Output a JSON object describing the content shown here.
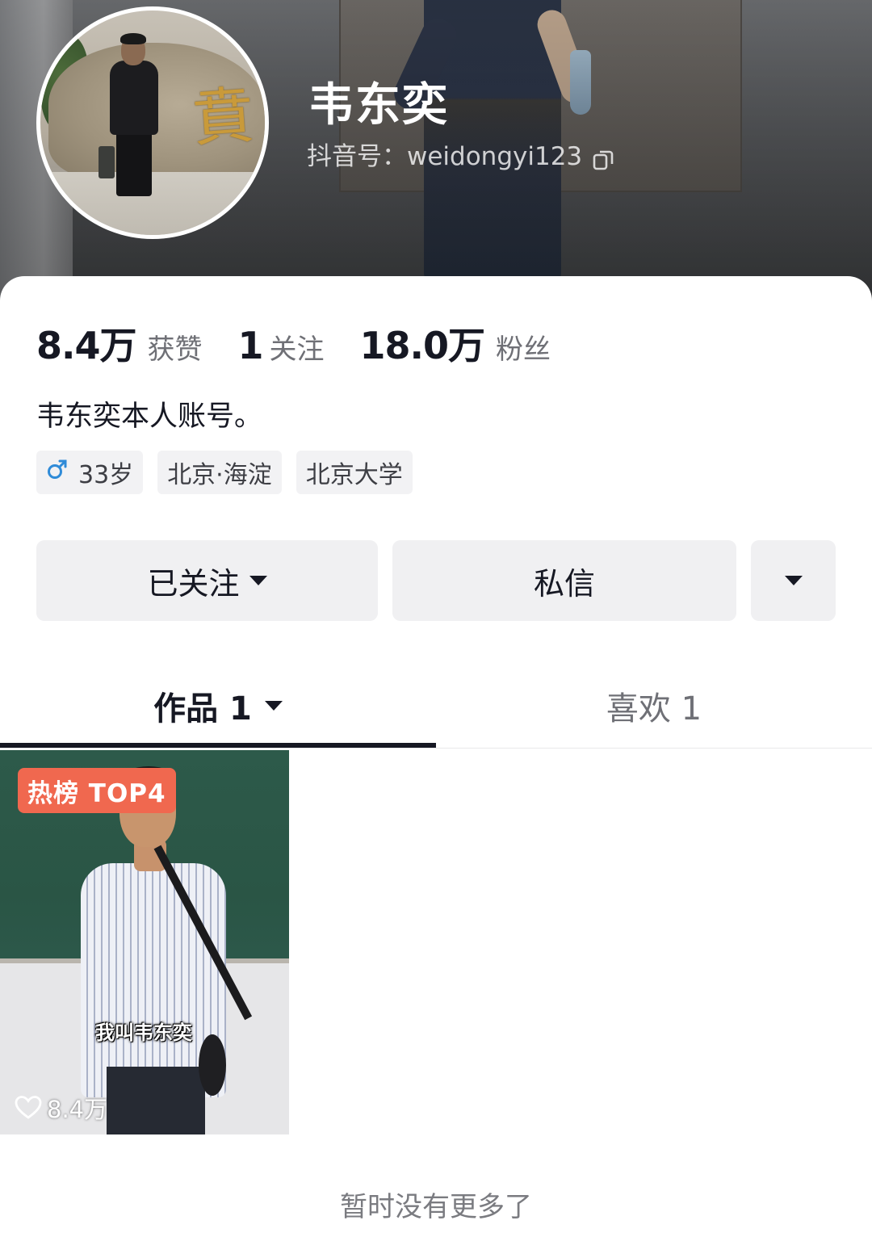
{
  "profile": {
    "name": "韦东奕",
    "douyin_id": "抖音号：weidongyi123",
    "bio": "韦东奕本人账号。"
  },
  "stats": [
    {
      "value": "8.4万",
      "label": "获赞"
    },
    {
      "value": "1",
      "label": "关注"
    },
    {
      "value": "18.0万",
      "label": "粉丝"
    }
  ],
  "tags": {
    "age": "33岁",
    "location": "北京·海淀",
    "school": "北京大学"
  },
  "actions": {
    "follow_label": "已关注",
    "message_label": "私信"
  },
  "tabs": {
    "works": "作品 1",
    "likes": "喜欢 1"
  },
  "video": {
    "hot_badge": "热榜 TOP4",
    "subtitle": "我叫韦东奕",
    "likes": "8.4万"
  },
  "footer": {
    "no_more": "暂时没有更多了"
  },
  "icons": {
    "copy": "copy-icon",
    "male": "male-gender-icon",
    "dropdown": "caret-down-icon",
    "heart": "heart-outline-icon"
  },
  "colors": {
    "accent_male": "#2f8bd8",
    "hot_badge": "#f0684f",
    "text_primary": "#161823",
    "text_secondary": "#6f7076"
  }
}
